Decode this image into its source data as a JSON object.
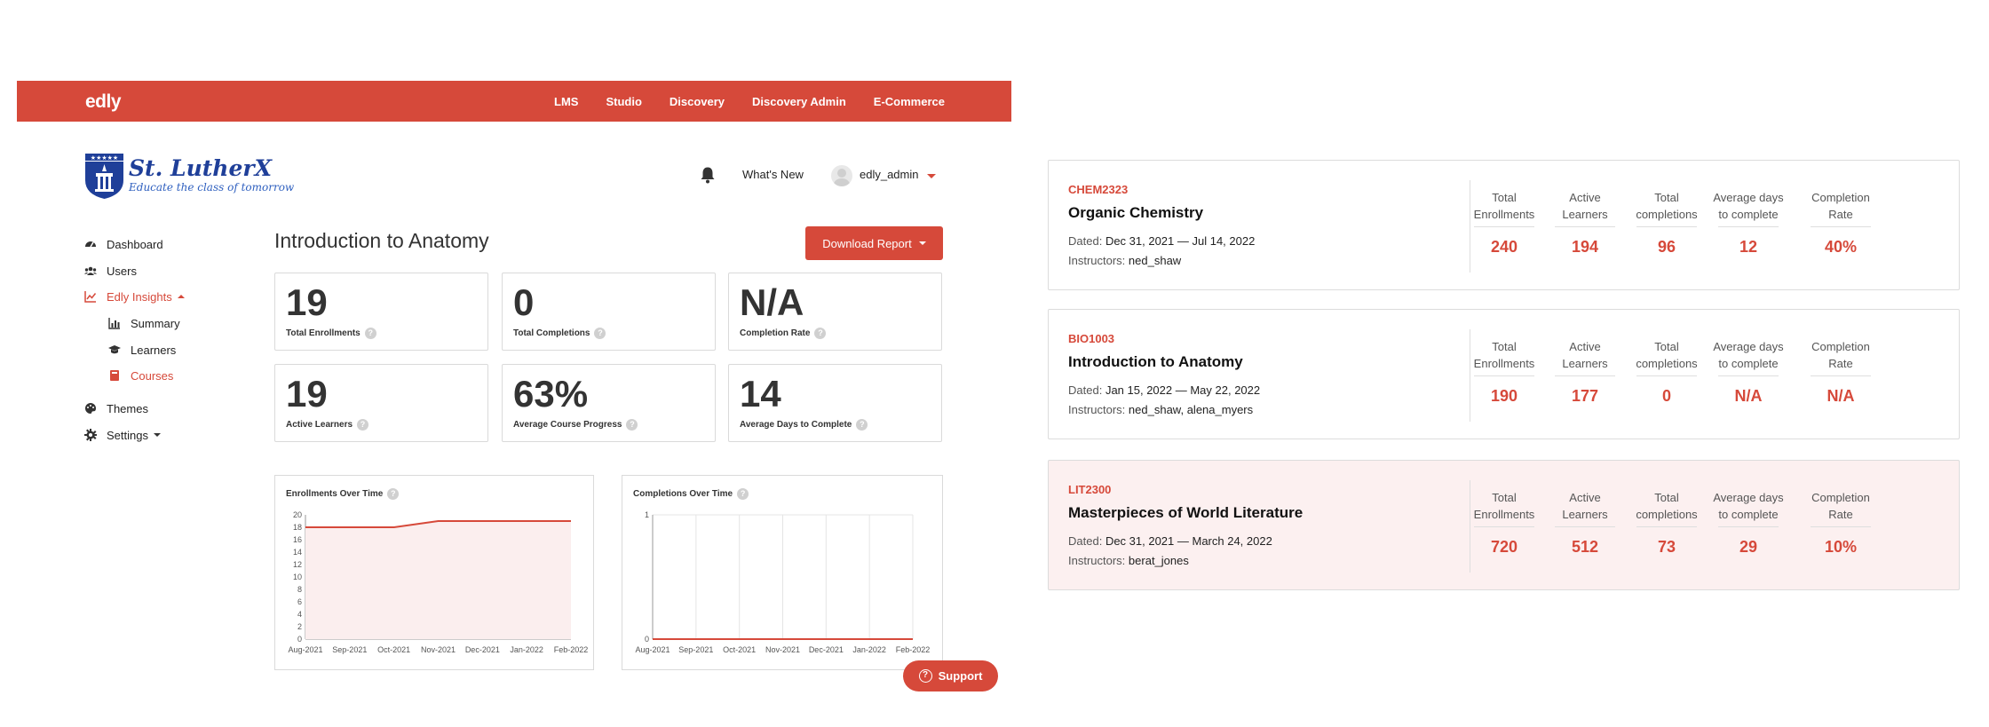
{
  "app": {
    "brand": "edly",
    "nav": [
      "LMS",
      "Studio",
      "Discovery",
      "Discovery Admin",
      "E-Commerce"
    ],
    "logo": {
      "title": "St. LutherX",
      "tagline": "Educate the class of tomorrow"
    },
    "header": {
      "whats_new": "What's New",
      "username": "edly_admin"
    },
    "sidebar": {
      "dashboard": "Dashboard",
      "users": "Users",
      "insights": "Edly Insights",
      "summary": "Summary",
      "learners": "Learners",
      "courses": "Courses",
      "themes": "Themes",
      "settings": "Settings"
    },
    "page_title": "Introduction to Anatomy",
    "download_label": "Download Report",
    "stats": [
      {
        "value": "19",
        "label": "Total Enrollments"
      },
      {
        "value": "0",
        "label": "Total Completions"
      },
      {
        "value": "N/A",
        "label": "Completion Rate"
      },
      {
        "value": "19",
        "label": "Active Learners"
      },
      {
        "value": "63%",
        "label": "Average Course Progress"
      },
      {
        "value": "14",
        "label": "Average Days to Complete"
      }
    ],
    "support_label": "Support",
    "colors": {
      "accent": "#d6493a",
      "highlight_bg": "#fcf0f0"
    }
  },
  "chart_data": [
    {
      "type": "area",
      "title": "Enrollments Over Time",
      "categories": [
        "Aug-2021",
        "Sep-2021",
        "Oct-2021",
        "Nov-2021",
        "Dec-2021",
        "Jan-2022",
        "Feb-2022"
      ],
      "values": [
        18,
        18,
        18,
        19,
        19,
        19,
        19
      ],
      "yticks": [
        0,
        2,
        4,
        6,
        8,
        10,
        12,
        14,
        16,
        18,
        20
      ],
      "ylim": [
        0,
        20
      ],
      "grid": false
    },
    {
      "type": "line",
      "title": "Completions Over Time",
      "categories": [
        "Aug-2021",
        "Sep-2021",
        "Oct-2021",
        "Nov-2021",
        "Dec-2021",
        "Jan-2022",
        "Feb-2022"
      ],
      "values": [
        0,
        0,
        0,
        0,
        0,
        0,
        0
      ],
      "yticks": [
        0,
        1
      ],
      "ylim": [
        0,
        1
      ],
      "grid": true
    }
  ],
  "courses": {
    "dated_label": "Dated:",
    "instructors_label": "Instructors:",
    "metric_headers": [
      [
        "Total",
        "Enrollments"
      ],
      [
        "Active",
        "Learners"
      ],
      [
        "Total",
        "completions"
      ],
      [
        "Average days",
        "to complete"
      ],
      [
        "Completion",
        "Rate"
      ]
    ],
    "items": [
      {
        "code": "CHEM2323",
        "name": "Organic Chemistry",
        "dated": "Dec 31, 2021 — Jul 14, 2022",
        "instructors": "ned_shaw",
        "metrics": [
          "240",
          "194",
          "96",
          "12",
          "40%"
        ]
      },
      {
        "code": "BIO1003",
        "name": "Introduction to Anatomy",
        "dated": "Jan 15, 2022 — May 22, 2022",
        "instructors": "ned_shaw, alena_myers",
        "metrics": [
          "190",
          "177",
          "0",
          "N/A",
          "N/A"
        ]
      },
      {
        "code": "LIT2300",
        "name": "Masterpieces of World Literature",
        "dated": "Dec 31, 2021 — March 24, 2022",
        "instructors": "berat_jones",
        "metrics": [
          "720",
          "512",
          "73",
          "29",
          "10%"
        ]
      }
    ]
  }
}
